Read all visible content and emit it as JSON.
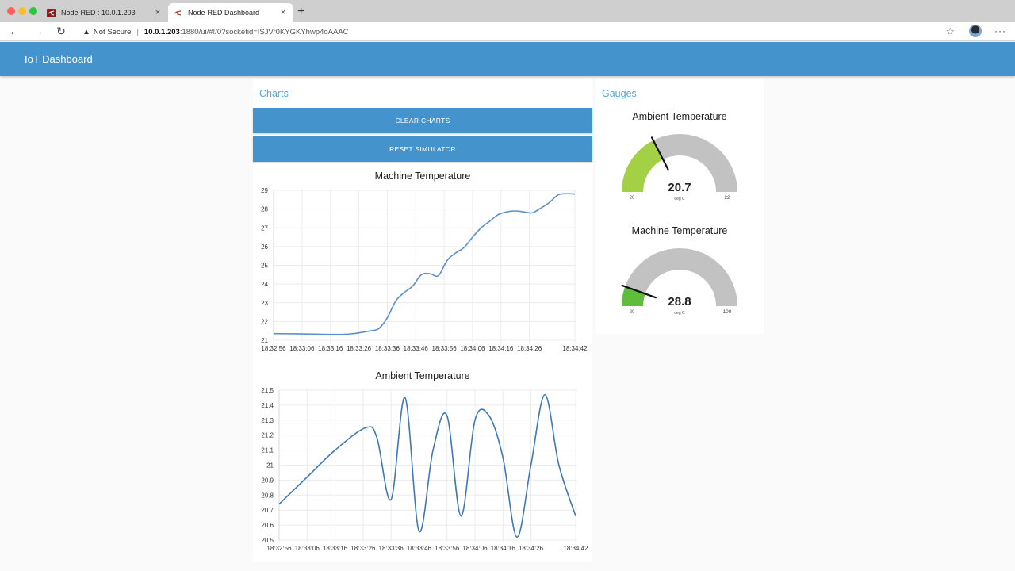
{
  "browser": {
    "tabs": [
      {
        "title": "Node-RED : 10.0.1.203",
        "active": false,
        "favicon": "node-red-icon"
      },
      {
        "title": "Node-RED Dashboard",
        "active": true,
        "favicon": "node-red-dashboard-icon"
      }
    ],
    "new_tab": "+",
    "close_glyph": "×",
    "security_label": "Not Secure",
    "url_host": "10.0.1.203",
    "url_rest": ":1880/ui/#!/0?socketid=ISJVr0KYGKYhwp4oAAAC",
    "nav": {
      "back": "←",
      "forward": "→",
      "reload": "↻"
    },
    "star": "☆",
    "more": "···"
  },
  "header": {
    "title": "IoT Dashboard"
  },
  "charts_group": {
    "title": "Charts",
    "buttons": [
      "CLEAR CHARTS",
      "RESET SIMULATOR"
    ]
  },
  "gauges_group": {
    "title": "Gauges",
    "gauges": [
      {
        "title": "Ambient Temperature",
        "value": "20.7",
        "units": "deg C",
        "min": "20",
        "max": "22",
        "fraction": 0.35,
        "color": "#a3d044"
      },
      {
        "title": "Machine Temperature",
        "value": "28.8",
        "units": "deg C",
        "min": "20",
        "max": "100",
        "fraction": 0.11,
        "color": "#5ebd3a"
      }
    ]
  },
  "chart_data": [
    {
      "type": "line",
      "title": "Machine Temperature",
      "xlabel": "",
      "ylabel": "",
      "x_ticks": [
        "18:32:56",
        "18:33:06",
        "18:33:16",
        "18:33:26",
        "18:33:36",
        "18:33:46",
        "18:33:56",
        "18:34:06",
        "18:34:16",
        "18:34:26",
        "18:34:42"
      ],
      "x_tick_seconds": [
        0,
        10,
        20,
        30,
        40,
        50,
        60,
        70,
        80,
        90,
        106
      ],
      "x_range_seconds": [
        0,
        106
      ],
      "ylim": [
        21,
        29
      ],
      "y_ticks": [
        21,
        22,
        23,
        24,
        25,
        26,
        27,
        28,
        29
      ],
      "grid": true,
      "line_color": "#5b8fc7",
      "series": [
        {
          "name": "Machine Temperature",
          "x_seconds": [
            0,
            8,
            16,
            24,
            28,
            31,
            34,
            37,
            40,
            43,
            46,
            49,
            52,
            55,
            58,
            61,
            64,
            67,
            70,
            73,
            76,
            79,
            82,
            85,
            88,
            91,
            94,
            97,
            100,
            103,
            106
          ],
          "values": [
            21.35,
            21.34,
            21.32,
            21.31,
            21.35,
            21.42,
            21.5,
            21.62,
            22.2,
            23.1,
            23.55,
            23.9,
            24.5,
            24.55,
            24.45,
            25.25,
            25.65,
            25.95,
            26.5,
            27.0,
            27.35,
            27.7,
            27.85,
            27.9,
            27.85,
            27.8,
            28.05,
            28.35,
            28.75,
            28.82,
            28.8
          ]
        }
      ]
    },
    {
      "type": "line",
      "title": "Ambient Temperature",
      "xlabel": "",
      "ylabel": "",
      "x_ticks": [
        "18:32:56",
        "18:33:06",
        "18:33:16",
        "18:33:26",
        "18:33:36",
        "18:33:46",
        "18:33:56",
        "18:34:06",
        "18:34:16",
        "18:34:26",
        "18:34:42"
      ],
      "x_tick_seconds": [
        0,
        10,
        20,
        30,
        40,
        50,
        60,
        70,
        80,
        90,
        106
      ],
      "x_range_seconds": [
        0,
        106
      ],
      "ylim": [
        20.5,
        21.5
      ],
      "y_ticks": [
        "20.5",
        "20.6",
        "20.7",
        "20.8",
        "20.9",
        "21",
        "21.1",
        "21.2",
        "21.3",
        "21.4",
        "21.5"
      ],
      "grid": true,
      "line_color": "#3f78b5",
      "series": [
        {
          "name": "Ambient Temperature",
          "x_seconds": [
            0,
            10,
            20,
            31,
            35,
            40,
            45,
            50,
            55,
            60,
            65,
            70,
            75,
            80,
            85,
            90,
            95,
            100,
            106
          ],
          "values": [
            20.74,
            20.92,
            21.1,
            21.25,
            21.18,
            20.77,
            21.45,
            20.56,
            21.1,
            21.33,
            20.66,
            21.3,
            21.33,
            21.05,
            20.52,
            21.0,
            21.47,
            21.0,
            20.66
          ]
        }
      ]
    }
  ]
}
